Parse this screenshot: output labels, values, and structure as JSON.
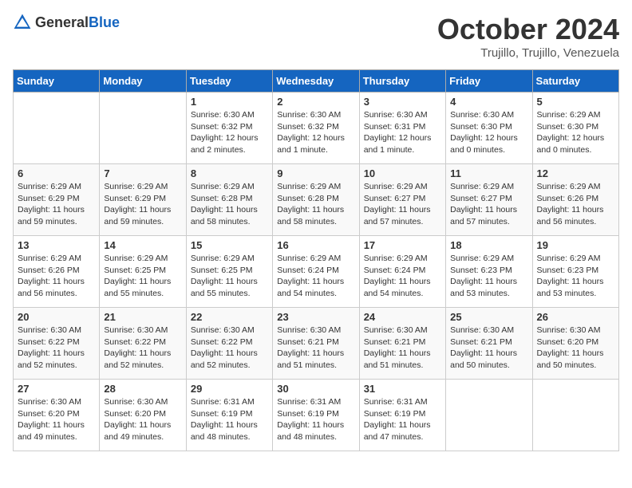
{
  "header": {
    "logo_general": "General",
    "logo_blue": "Blue",
    "month_title": "October 2024",
    "location": "Trujillo, Trujillo, Venezuela"
  },
  "weekdays": [
    "Sunday",
    "Monday",
    "Tuesday",
    "Wednesday",
    "Thursday",
    "Friday",
    "Saturday"
  ],
  "weeks": [
    [
      {
        "day": "",
        "info": ""
      },
      {
        "day": "",
        "info": ""
      },
      {
        "day": "1",
        "info": "Sunrise: 6:30 AM\nSunset: 6:32 PM\nDaylight: 12 hours and 2 minutes."
      },
      {
        "day": "2",
        "info": "Sunrise: 6:30 AM\nSunset: 6:32 PM\nDaylight: 12 hours and 1 minute."
      },
      {
        "day": "3",
        "info": "Sunrise: 6:30 AM\nSunset: 6:31 PM\nDaylight: 12 hours and 1 minute."
      },
      {
        "day": "4",
        "info": "Sunrise: 6:30 AM\nSunset: 6:30 PM\nDaylight: 12 hours and 0 minutes."
      },
      {
        "day": "5",
        "info": "Sunrise: 6:29 AM\nSunset: 6:30 PM\nDaylight: 12 hours and 0 minutes."
      }
    ],
    [
      {
        "day": "6",
        "info": "Sunrise: 6:29 AM\nSunset: 6:29 PM\nDaylight: 11 hours and 59 minutes."
      },
      {
        "day": "7",
        "info": "Sunrise: 6:29 AM\nSunset: 6:29 PM\nDaylight: 11 hours and 59 minutes."
      },
      {
        "day": "8",
        "info": "Sunrise: 6:29 AM\nSunset: 6:28 PM\nDaylight: 11 hours and 58 minutes."
      },
      {
        "day": "9",
        "info": "Sunrise: 6:29 AM\nSunset: 6:28 PM\nDaylight: 11 hours and 58 minutes."
      },
      {
        "day": "10",
        "info": "Sunrise: 6:29 AM\nSunset: 6:27 PM\nDaylight: 11 hours and 57 minutes."
      },
      {
        "day": "11",
        "info": "Sunrise: 6:29 AM\nSunset: 6:27 PM\nDaylight: 11 hours and 57 minutes."
      },
      {
        "day": "12",
        "info": "Sunrise: 6:29 AM\nSunset: 6:26 PM\nDaylight: 11 hours and 56 minutes."
      }
    ],
    [
      {
        "day": "13",
        "info": "Sunrise: 6:29 AM\nSunset: 6:26 PM\nDaylight: 11 hours and 56 minutes."
      },
      {
        "day": "14",
        "info": "Sunrise: 6:29 AM\nSunset: 6:25 PM\nDaylight: 11 hours and 55 minutes."
      },
      {
        "day": "15",
        "info": "Sunrise: 6:29 AM\nSunset: 6:25 PM\nDaylight: 11 hours and 55 minutes."
      },
      {
        "day": "16",
        "info": "Sunrise: 6:29 AM\nSunset: 6:24 PM\nDaylight: 11 hours and 54 minutes."
      },
      {
        "day": "17",
        "info": "Sunrise: 6:29 AM\nSunset: 6:24 PM\nDaylight: 11 hours and 54 minutes."
      },
      {
        "day": "18",
        "info": "Sunrise: 6:29 AM\nSunset: 6:23 PM\nDaylight: 11 hours and 53 minutes."
      },
      {
        "day": "19",
        "info": "Sunrise: 6:29 AM\nSunset: 6:23 PM\nDaylight: 11 hours and 53 minutes."
      }
    ],
    [
      {
        "day": "20",
        "info": "Sunrise: 6:30 AM\nSunset: 6:22 PM\nDaylight: 11 hours and 52 minutes."
      },
      {
        "day": "21",
        "info": "Sunrise: 6:30 AM\nSunset: 6:22 PM\nDaylight: 11 hours and 52 minutes."
      },
      {
        "day": "22",
        "info": "Sunrise: 6:30 AM\nSunset: 6:22 PM\nDaylight: 11 hours and 52 minutes."
      },
      {
        "day": "23",
        "info": "Sunrise: 6:30 AM\nSunset: 6:21 PM\nDaylight: 11 hours and 51 minutes."
      },
      {
        "day": "24",
        "info": "Sunrise: 6:30 AM\nSunset: 6:21 PM\nDaylight: 11 hours and 51 minutes."
      },
      {
        "day": "25",
        "info": "Sunrise: 6:30 AM\nSunset: 6:21 PM\nDaylight: 11 hours and 50 minutes."
      },
      {
        "day": "26",
        "info": "Sunrise: 6:30 AM\nSunset: 6:20 PM\nDaylight: 11 hours and 50 minutes."
      }
    ],
    [
      {
        "day": "27",
        "info": "Sunrise: 6:30 AM\nSunset: 6:20 PM\nDaylight: 11 hours and 49 minutes."
      },
      {
        "day": "28",
        "info": "Sunrise: 6:30 AM\nSunset: 6:20 PM\nDaylight: 11 hours and 49 minutes."
      },
      {
        "day": "29",
        "info": "Sunrise: 6:31 AM\nSunset: 6:19 PM\nDaylight: 11 hours and 48 minutes."
      },
      {
        "day": "30",
        "info": "Sunrise: 6:31 AM\nSunset: 6:19 PM\nDaylight: 11 hours and 48 minutes."
      },
      {
        "day": "31",
        "info": "Sunrise: 6:31 AM\nSunset: 6:19 PM\nDaylight: 11 hours and 47 minutes."
      },
      {
        "day": "",
        "info": ""
      },
      {
        "day": "",
        "info": ""
      }
    ]
  ]
}
